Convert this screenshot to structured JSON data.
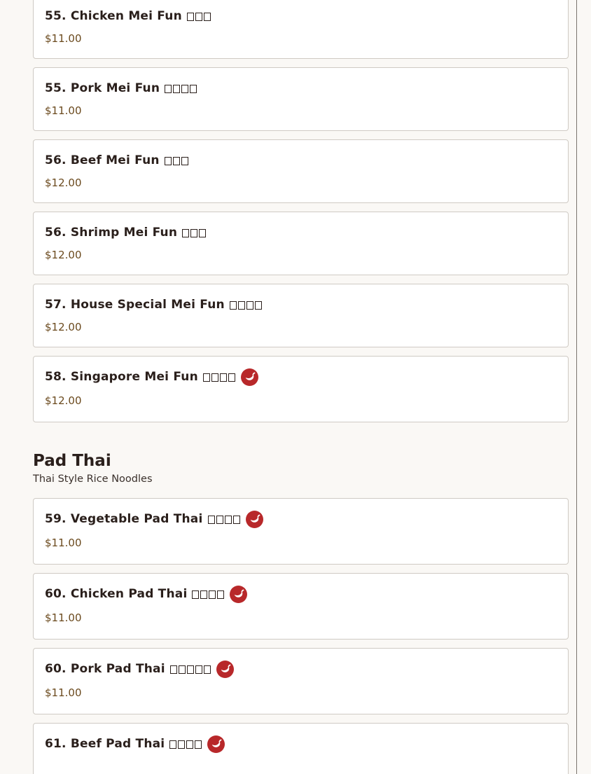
{
  "menu": {
    "mei_fun_items": [
      {
        "name": "55. Chicken Mei Fun",
        "cjk_chars": 3,
        "price": "$11.00",
        "spicy": false
      },
      {
        "name": "55. Pork Mei Fun",
        "cjk_chars": 4,
        "price": "$11.00",
        "spicy": false
      },
      {
        "name": "56. Beef Mei Fun",
        "cjk_chars": 3,
        "price": "$12.00",
        "spicy": false
      },
      {
        "name": "56. Shrimp Mei Fun",
        "cjk_chars": 3,
        "price": "$12.00",
        "spicy": false
      },
      {
        "name": "57. House Special Mei Fun",
        "cjk_chars": 4,
        "price": "$12.00",
        "spicy": false
      },
      {
        "name": "58. Singapore Mei Fun",
        "cjk_chars": 4,
        "price": "$12.00",
        "spicy": true
      }
    ],
    "pad_thai_section": {
      "title": "Pad Thai",
      "subtitle": "Thai Style Rice Noodles",
      "items": [
        {
          "name": "59. Vegetable Pad Thai",
          "cjk_chars": 4,
          "price": "$11.00",
          "spicy": true
        },
        {
          "name": "60. Chicken Pad Thai",
          "cjk_chars": 4,
          "price": "$11.00",
          "spicy": true
        },
        {
          "name": "60. Pork Pad Thai",
          "cjk_chars": 5,
          "price": "$11.00",
          "spicy": true
        },
        {
          "name": "61. Beef Pad Thai",
          "cjk_chars": 4,
          "price": "",
          "spicy": true
        }
      ]
    }
  },
  "icons": {
    "spicy": "chili-pepper-icon"
  },
  "colors": {
    "spicy_icon": "#b8282a",
    "price_text": "#6b4a1e",
    "card_border": "#cfcac4",
    "background": "#faf8f5"
  }
}
